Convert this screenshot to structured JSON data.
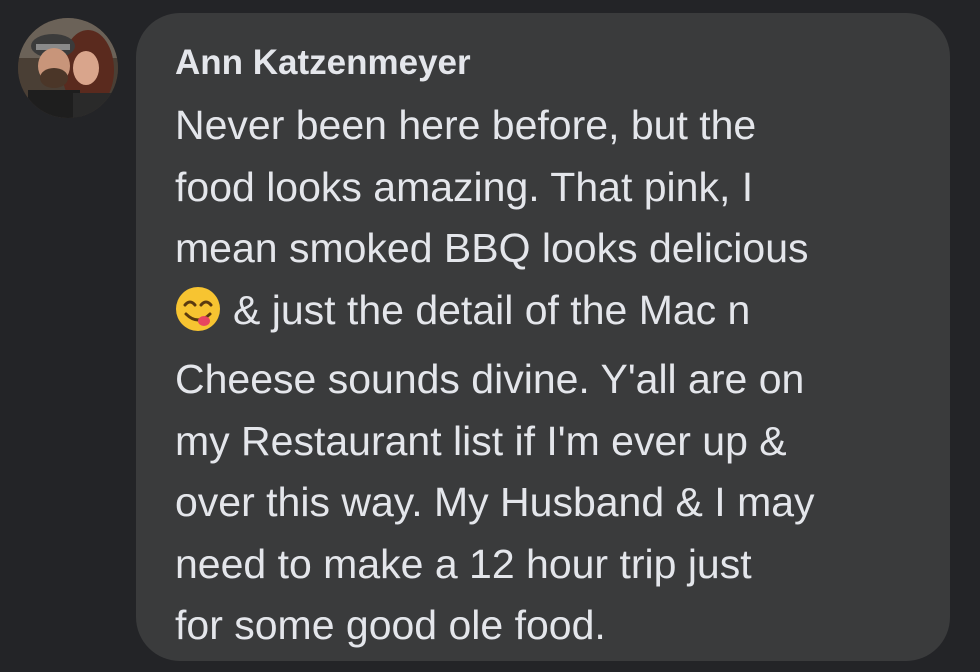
{
  "comment": {
    "author": "Ann Katzenmeyer",
    "emoji_icon": "face-savoring-food-emoji",
    "lines": [
      "Never been here before, but the",
      "food looks amazing. That pink, I",
      "mean smoked BBQ looks delicious",
      "& just the detail of the Mac n",
      "Cheese sounds divine. Y'all are on",
      "my Restaurant list if I'm ever up &",
      "over this way. My Husband & I may",
      "need to make a 12 hour trip just",
      "for some good ole food."
    ]
  },
  "colors": {
    "background": "#232427",
    "bubble": "#3a3b3c",
    "text": "#e4e6eb"
  }
}
